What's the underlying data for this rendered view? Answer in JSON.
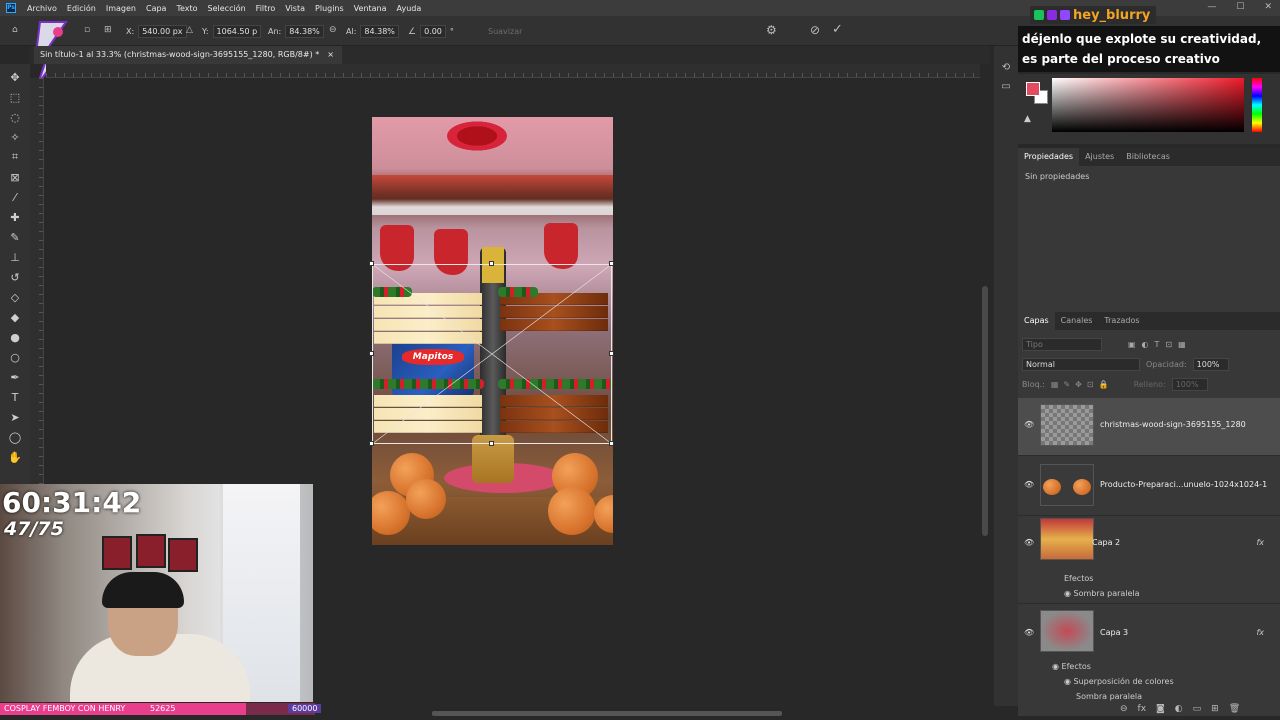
{
  "app": {
    "logo": "Ps",
    "menu": [
      "Archivo",
      "Edición",
      "Imagen",
      "Capa",
      "Texto",
      "Selección",
      "Filtro",
      "Vista",
      "Plugins",
      "Ventana",
      "Ayuda"
    ]
  },
  "options_bar": {
    "x_label": "X:",
    "x_value": "540.00 px",
    "y_label": "Y:",
    "y_value": "1064.50 p",
    "w_label": "An:",
    "w_value": "84.38%",
    "h_label": "Al:",
    "h_value": "84.38%",
    "angle_value": "0.00",
    "angle_unit": "°",
    "smooth_label": "Suavizar"
  },
  "document": {
    "tab_title": "Sin título-1 al 33.3% (christmas-wood-sign-3695155_1280, RGB/8#) *",
    "tab_close": "×",
    "chips_brand": "Mapitos"
  },
  "overlay": {
    "timer": "60:31:42",
    "count": "47/75",
    "goal_label": "COSPLAY FEMBOY CON HENRY",
    "goal_current": "52625",
    "goal_target": "60000",
    "goal_progress": 0.877,
    "accent": "#e83e8c"
  },
  "chat": {
    "username": "hey_blurry",
    "username_color": "#f4a323",
    "message": "déjenlo que explote su creatividad, es parte del proceso creativo"
  },
  "properties_panel": {
    "tabs": [
      "Propiedades",
      "Ajustes",
      "Bibliotecas"
    ],
    "empty_text": "Sin propiedades"
  },
  "layers_panel": {
    "tabs": [
      "Capas",
      "Canales",
      "Trazados"
    ],
    "search_placeholder": "Tipo",
    "blend_mode": "Normal",
    "opacity_label": "Opacidad:",
    "opacity_value": "100%",
    "lock_label": "Bloq.:",
    "fill_label": "Relleno:",
    "fill_value": "100%",
    "layers": [
      {
        "name": "christmas-wood-sign-3695155_1280",
        "visible": true,
        "selected": true
      },
      {
        "name": "Producto-Preparaci...unuelo-1024x1024-1",
        "visible": true,
        "selected": false
      },
      {
        "name": "Capa 2",
        "visible": true,
        "selected": false,
        "fx": "fx",
        "effects_label": "Efectos",
        "effects": [
          "Sombra paralela"
        ]
      },
      {
        "name": "Capa 3",
        "visible": true,
        "selected": false,
        "fx": "fx",
        "effects_label": "Efectos",
        "effects": [
          "Superposición de colores",
          "Sombra paralela"
        ]
      }
    ]
  },
  "icons": [
    "move-icon",
    "marquee-icon",
    "lasso-icon",
    "magic-wand-icon",
    "crop-icon",
    "frame-icon",
    "eyedropper-icon",
    "healing-icon",
    "brush-icon",
    "stamp-icon",
    "history-brush-icon",
    "eraser-icon",
    "bucket-icon",
    "blur-icon",
    "dodge-icon",
    "pen-icon",
    "type-icon",
    "path-select-icon",
    "shape-icon",
    "hand-icon",
    "eye-icon",
    "cancel-icon",
    "commit-icon",
    "warp-icon"
  ]
}
